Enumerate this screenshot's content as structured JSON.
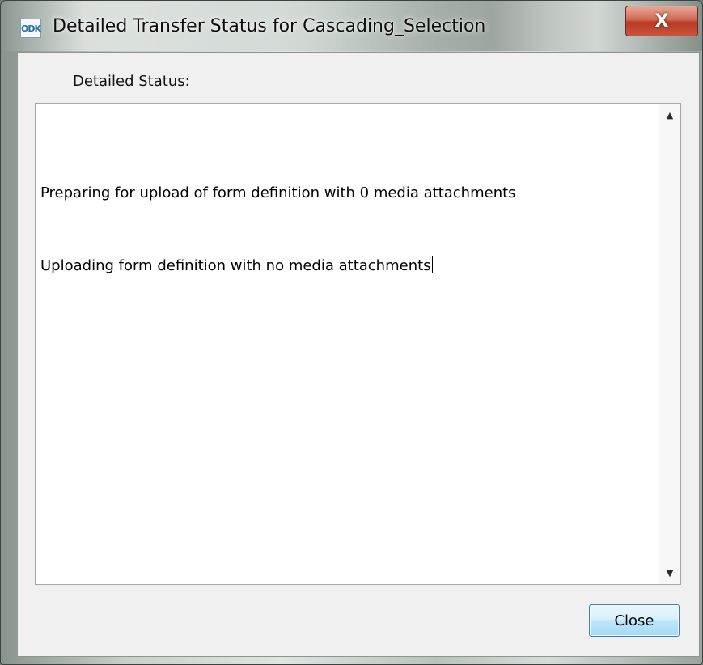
{
  "window": {
    "title": "Detailed Transfer Status for Cascading_Selection",
    "app_icon_text": "ODK",
    "close_glyph": "X"
  },
  "dialog": {
    "status_label": "Detailed Status:",
    "status_lines": [
      "Preparing for upload of form definition with 0 media attachments",
      "Uploading form definition with no media attachments"
    ],
    "close_button_label": "Close"
  },
  "colors": {
    "close_x_button": "#c9553c",
    "close_button_border": "#3c7fb1"
  }
}
